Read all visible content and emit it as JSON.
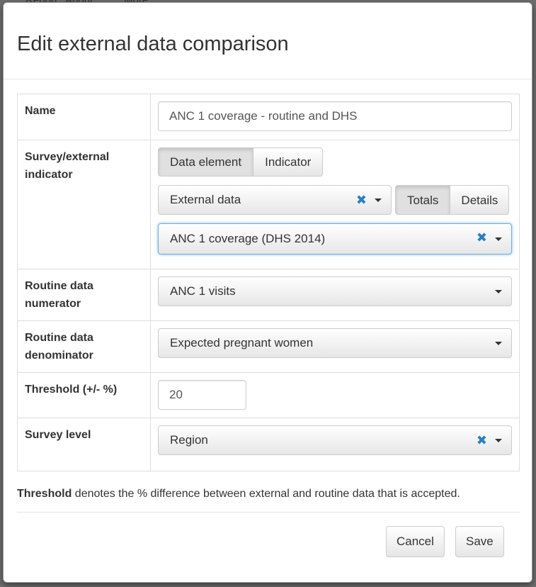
{
  "backdrop": {
    "items": [
      "Report",
      "About",
      "More"
    ]
  },
  "modal": {
    "title": "Edit external data comparison",
    "rows": {
      "name": {
        "label": "Name",
        "value": "ANC 1 coverage - routine and DHS"
      },
      "survey": {
        "label": "Survey/external indicator",
        "type_options": [
          "Data element",
          "Indicator"
        ],
        "type_selected": "Data element",
        "source_select": "External data",
        "mode_options": [
          "Totals",
          "Details"
        ],
        "mode_selected": "Totals",
        "indicator_select": "ANC 1 coverage (DHS 2014)"
      },
      "numerator": {
        "label": "Routine data numerator",
        "value": "ANC 1 visits"
      },
      "denominator": {
        "label": "Routine data denominator",
        "value": "Expected pregnant women"
      },
      "threshold": {
        "label": "Threshold (+/- %)",
        "value": "20"
      },
      "level": {
        "label": "Survey level",
        "value": "Region"
      }
    },
    "help": {
      "bold": "Threshold",
      "text": " denotes the % difference between external and routine data that is accepted."
    },
    "footer": {
      "cancel_label": "Cancel",
      "save_label": "Save"
    },
    "clear_glyph": "✖"
  },
  "colors": {
    "accent": "#2a7ec2",
    "focus": "#66afe9"
  }
}
